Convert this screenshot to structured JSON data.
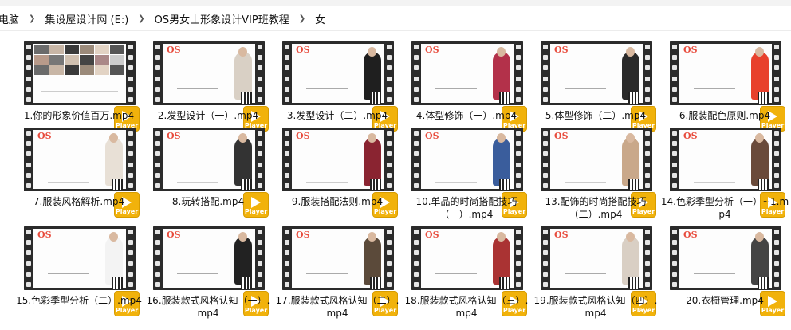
{
  "breadcrumb": [
    "电脑",
    "集设屋设计网 (E:)",
    "OS男女士形象设计VIP班教程",
    "女"
  ],
  "player_label": "Player",
  "colors": {
    "player": "#f1b20b",
    "accent_red": "#d22222"
  },
  "files": [
    {
      "name": "1.你的形象价值百万.mp4"
    },
    {
      "name": "2.发型设计（一）.mp4"
    },
    {
      "name": "3.发型设计（二）.mp4"
    },
    {
      "name": "4.体型修饰（一）.mp4"
    },
    {
      "name": "5.体型修饰（二）.mp4"
    },
    {
      "name": "6.服装配色原则.mp4"
    },
    {
      "name": "7.服装风格解析.mp4"
    },
    {
      "name": "8.玩转搭配.mp4"
    },
    {
      "name": "9.服装搭配法则.mp4"
    },
    {
      "name": "10.单品的时尚搭配技巧（一）.mp4"
    },
    {
      "name": "13.配饰的时尚搭配技巧（二）.mp4"
    },
    {
      "name": "14.色彩季型分析（一）~1.mp4"
    },
    {
      "name": "15.色彩季型分析（二）.mp4"
    },
    {
      "name": "16.服装款式风格认知（一）.mp4"
    },
    {
      "name": "17.服装款式风格认知（二）.mp4"
    },
    {
      "name": "18.服装款式风格认知（三）.mp4"
    },
    {
      "name": "19.服装款式风格认知（四）.mp4"
    },
    {
      "name": "20.衣橱管理.mp4"
    }
  ]
}
